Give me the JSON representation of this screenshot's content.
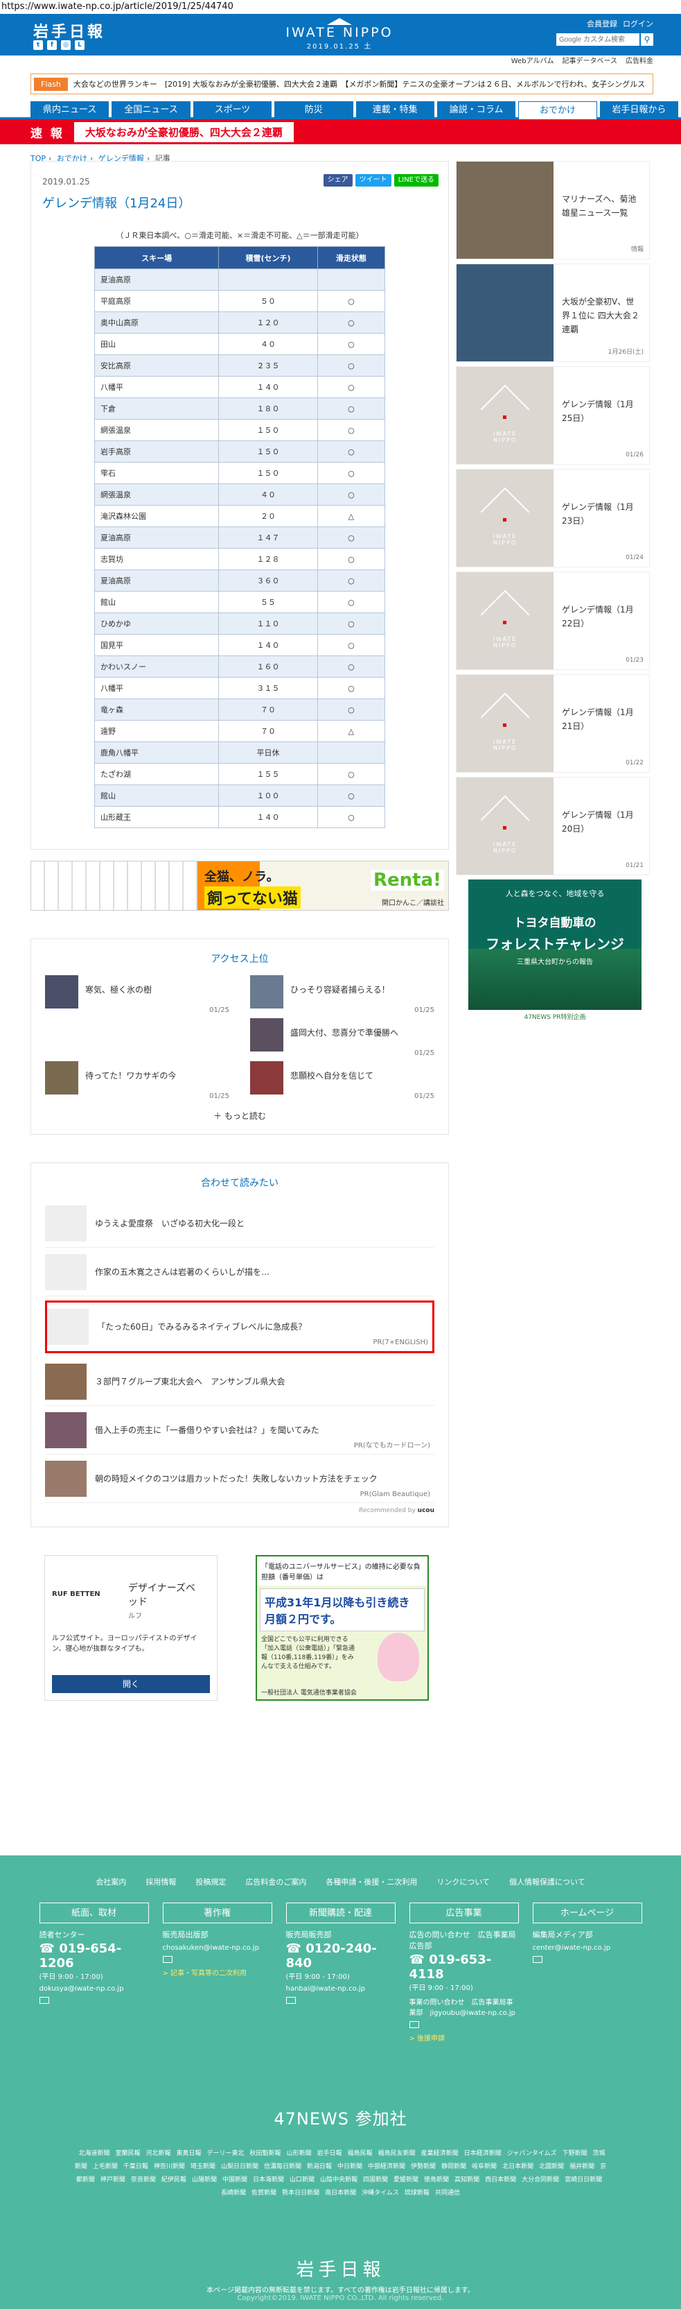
{
  "url": "https://www.iwate-np.co.jp/article/2019/1/25/44740",
  "header": {
    "logo": "岩手日報",
    "brand": "IWATE NIPPO",
    "date": "2019.01.25 土",
    "links": [
      "会員登録",
      "ログイン"
    ],
    "search_placeholder": "Google カスタム検索",
    "sub": [
      "Webアルバム",
      "記事データベース",
      "広告料金"
    ]
  },
  "flash": {
    "tag": "Flash",
    "text": "大会などの世界ランキー　[2019] 大坂なおみが全豪初優勝、四大大会２連覇　【メガポン新聞】テニスの全豪オープンは２６日、メルボルンで行われ、女子シングルス"
  },
  "nav": [
    "県内ニュース",
    "全国ニュース",
    "スポーツ",
    "防災",
    "連載・特集",
    "論説・コラム",
    "おでかけ",
    "岩手日報から"
  ],
  "breaking": {
    "label": "速 報",
    "text": "大坂なおみが全豪初優勝、四大大会２連覇"
  },
  "breadcrumb": [
    "TOP",
    "おでかけ",
    "ゲレンデ情報",
    "記事"
  ],
  "article": {
    "date": "2019.01.25",
    "title": "ゲレンデ情報（1月24日）",
    "share": [
      "シェア",
      "ツイート",
      "LINEで送る"
    ],
    "note": "（ＪＲ東日本調べ、○＝滑走可能、×＝滑走不可能、△＝一部滑走可能）",
    "headers": [
      "スキー場",
      "積雪(センチ)",
      "滑走状態"
    ],
    "rows": [
      [
        "夏油高原",
        "",
        ""
      ],
      [
        "平庭高原",
        "５０",
        "○"
      ],
      [
        "奥中山高原",
        "１２０",
        "○"
      ],
      [
        "田山",
        "４０",
        "○"
      ],
      [
        "安比高原",
        "２３５",
        "○"
      ],
      [
        "八幡平",
        "１４０",
        "○"
      ],
      [
        "下倉",
        "１８０",
        "○"
      ],
      [
        "網張温泉",
        "１５０",
        "○"
      ],
      [
        "岩手高原",
        "１５０",
        "○"
      ],
      [
        "雫石",
        "１５０",
        "○"
      ],
      [
        "網張温泉",
        "４０",
        "○"
      ],
      [
        "滝沢森林公園",
        "２０",
        "△"
      ],
      [
        "夏油高原",
        "１４７",
        "○"
      ],
      [
        "志賀坊",
        "１２８",
        "○"
      ],
      [
        "夏油高原",
        "３６０",
        "○"
      ],
      [
        "館山",
        "５５",
        "○"
      ],
      [
        "ひめかゆ",
        "１１０",
        "○"
      ],
      [
        "国見平",
        "１４０",
        "○"
      ],
      [
        "かわいスノー",
        "１６０",
        "○"
      ],
      [
        "八幡平",
        "３１５",
        "○"
      ],
      [
        "竜ヶ森",
        "７０",
        "○"
      ],
      [
        "遠野",
        "７０",
        "△"
      ],
      [
        "鹿角八幡平",
        "平日休",
        ""
      ],
      [
        "たざわ湖",
        "１５５",
        "○"
      ],
      [
        "館山",
        "１００",
        "○"
      ],
      [
        "山形蔵王",
        "１４０",
        "○"
      ]
    ]
  },
  "ad_banner": {
    "text1": "全猫、ノラ。",
    "text2": "飼ってない猫",
    "brand": "Renta!",
    "credit": "関口かんこ／講談社"
  },
  "ranking": {
    "title": "アクセス上位",
    "items": [
      {
        "title": "寒気、極く氷の樹",
        "date": "01/25"
      },
      {
        "title": "ひっそり容疑者捕らえる！",
        "date": "01/25"
      },
      {
        "title": "",
        "date": ""
      },
      {
        "title": "盛岡大付、悲喜分で準優勝へ",
        "date": "01/25"
      },
      {
        "title": "待ってた！ワカサギの今",
        "date": "01/25"
      },
      {
        "title": "悲願校へ自分を信じて",
        "date": "01/25"
      }
    ],
    "more": "もっと読む"
  },
  "related": {
    "title": "合わせて読みたい",
    "items": [
      {
        "title": "ゆうえよ愛度祭　いざゆる初大化一段と",
        "pr": ""
      },
      {
        "title": "作家の五木寛之さんは岩著のくらいしが描を…",
        "pr": ""
      },
      {
        "title": "「たった60日」でみるみるネイティブレベルに急成長？",
        "pr": "PR(7+ENGLISH)"
      },
      {
        "title": "３部門７グループ東北大会へ　アンサンブル県大会",
        "pr": ""
      },
      {
        "title": "借入上手の売主に「一番借りやすい会社は？」を聞いてみた",
        "pr": "PR(なでもカードローン)"
      },
      {
        "title": "朝の時短メイクのコツは眉カットだった！失敗しないカット方法をチェック",
        "pr": "PR(Glam Beautique)"
      }
    ],
    "recommended": "Recommended by"
  },
  "ad_furniture": {
    "brand": "RUF BETTEN",
    "title": "デザイナーズベッド",
    "sub": "ルフ",
    "desc": "ルフ公式サイト。ヨーロッパテイストのデザイン、寝心地が抜群なタイプも。",
    "btn": "開く"
  },
  "ad_phone": {
    "head": "「電話のユニバーサルサービス」の維持に必要な負担額（番号単価）は",
    "main": "平成31年1月以降も引き続き月額２円です。",
    "body": "全国どこでも公平に利用できる「加入電話（公衆電話）」「緊急通報（110番,118番,119番）」をみんなで支える仕組みです。",
    "foot": "一般社団法人 電気通信事業者協会"
  },
  "side": [
    {
      "title": "マリナーズへ、菊池雄星ニュース一覧",
      "date": "情報",
      "img": "photo"
    },
    {
      "title": "大坂が全豪初V、世界１位に 四大大会２連覇",
      "date": "1月26日(土)",
      "img": "photo"
    },
    {
      "title": "ゲレンデ情報（1月25日）",
      "date": "01/26",
      "img": "ph"
    },
    {
      "title": "ゲレンデ情報（1月23日）",
      "date": "01/24",
      "img": "ph"
    },
    {
      "title": "ゲレンデ情報（1月22日）",
      "date": "01/23",
      "img": "ph"
    },
    {
      "title": "ゲレンデ情報（1月21日）",
      "date": "01/22",
      "img": "ph"
    },
    {
      "title": "ゲレンデ情報（1月20日）",
      "date": "01/21",
      "img": "ph"
    }
  ],
  "sideAd": {
    "top": "人と森をつなぐ、地域を守る",
    "brand": "トヨタ自動車の",
    "main": "フォレストチャレンジ",
    "sub": "三重県大台町からの報告",
    "foot": "47NEWS PR特別企画"
  },
  "footer": {
    "links": [
      "会社案内",
      "採用情報",
      "投稿規定",
      "広告料金のご案内",
      "各種申請・後援・二次利用",
      "リンクについて",
      "個人情報保護について"
    ],
    "cols": [
      {
        "h": "紙面、取材",
        "t": "読者センター",
        "ph": "019-654-1206",
        "s": "(平日 9:00 - 17:00)",
        "m": "dokusya@iwate-np.co.jp",
        "y": ""
      },
      {
        "h": "著作権",
        "t": "販売局出版部",
        "ph": "",
        "s": "",
        "m": "chosakuken@iwate-np.co.jp",
        "y": "> 記事・写真等の二次利用"
      },
      {
        "h": "新聞購読・配達",
        "t": "販売局販売部",
        "ph": "0120-240-840",
        "s": "(平日 9:00 - 17:00)",
        "m": "hanbai@iwate-np.co.jp",
        "y": ""
      },
      {
        "h": "広告事業",
        "t": "広告の問い合わせ　広告事業局広告部",
        "ph": "019-653-4118",
        "s": "(平日 9:00 - 17:00)",
        "m": "事業の問い合わせ　広告事業局事業部　jigyoubu@iwate-np.co.jp",
        "y": "> 後援申請"
      },
      {
        "h": "ホームページ",
        "t": "編集局メディア部",
        "ph": "",
        "s": "",
        "m": "center@iwate-np.co.jp",
        "y": ""
      }
    ],
    "n47": "47NEWS 参加社",
    "papers": [
      "北海道新聞",
      "室蘭民報",
      "河北新報",
      "東奥日報",
      "デーリー東北",
      "秋田魁新報",
      "山形新聞",
      "岩手日報",
      "福島民報",
      "福島民友新聞",
      "産業経済新聞",
      "日本経済新聞",
      "ジャパンタイムズ",
      "下野新聞",
      "茨城新聞",
      "上毛新聞",
      "千葉日報",
      "神奈川新聞",
      "埼玉新聞",
      "山梨日日新聞",
      "信濃毎日新聞",
      "新潟日報",
      "中日新聞",
      "中部経済新聞",
      "伊勢新聞",
      "静岡新聞",
      "岐阜新聞",
      "北日本新聞",
      "北國新聞",
      "福井新聞",
      "京都新聞",
      "神戸新聞",
      "奈良新聞",
      "紀伊民報",
      "山陽新聞",
      "中国新聞",
      "日本海新聞",
      "山口新聞",
      "山陰中央新報",
      "四国新聞",
      "愛媛新聞",
      "徳島新聞",
      "高知新聞",
      "西日本新聞",
      "大分合同新聞",
      "宮崎日日新聞",
      "長崎新聞",
      "佐賀新聞",
      "熊本日日新聞",
      "南日本新聞",
      "沖縄タイムス",
      "琉球新報",
      "共同通信"
    ],
    "logo": "岩手日報",
    "copy": "本ページ掲載内容の無断転載を禁じます。すべての著作権は岩手日報社に帰属します。",
    "copy2": "Copyright©2019. IWATE NIPPO CO.,LTD. All rights reserved."
  }
}
